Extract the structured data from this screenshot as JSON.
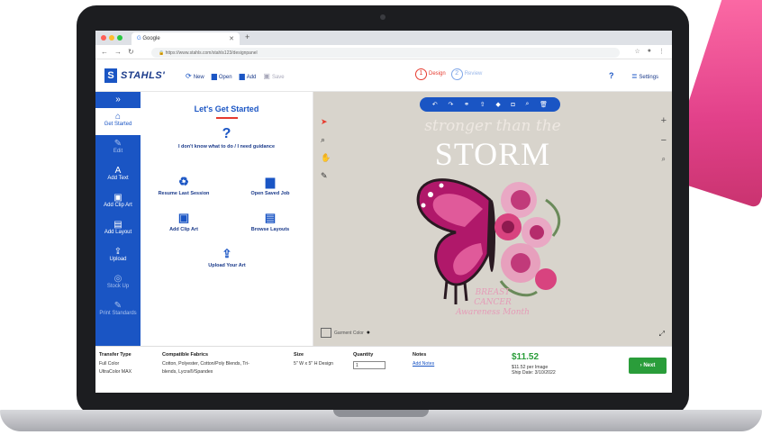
{
  "browser": {
    "tab_title": "Google",
    "url": "https://www.stahls.com/stahls123/designpanel"
  },
  "header": {
    "logo_text": "STAHLS'",
    "actions": [
      "New",
      "Open",
      "Add",
      "Save"
    ],
    "steps": [
      {
        "num": "1",
        "label": "Design"
      },
      {
        "num": "2",
        "label": "Review"
      }
    ],
    "help": "?",
    "settings": "Settings"
  },
  "sidebar": {
    "collapse": "»",
    "items": [
      {
        "label": "Get Started",
        "icon": "home-icon"
      },
      {
        "label": "Edit",
        "icon": "pencil-icon"
      },
      {
        "label": "Add Text",
        "icon": "text-icon"
      },
      {
        "label": "Add Clip Art",
        "icon": "image-icon"
      },
      {
        "label": "Add Layout",
        "icon": "layout-icon"
      },
      {
        "label": "Upload",
        "icon": "upload-icon"
      },
      {
        "label": "Stock Up",
        "icon": "stock-icon"
      },
      {
        "label": "Print Standards",
        "icon": "print-icon"
      }
    ]
  },
  "panel": {
    "title": "Let's Get Started",
    "question_mark": "?",
    "guidance": "I don't know what to do / I need guidance",
    "options": [
      {
        "label": "Resume Last Session",
        "icon": "recycle-icon"
      },
      {
        "label": "Open Saved Job",
        "icon": "folder-icon"
      },
      {
        "label": "Add Clip Art",
        "icon": "image-icon"
      },
      {
        "label": "Browse Layouts",
        "icon": "layouts-icon"
      },
      {
        "label": "Upload Your Art",
        "icon": "upload-icon"
      }
    ]
  },
  "canvas": {
    "art_line1": "stronger than the",
    "art_line2": "STORM",
    "art_sub": [
      "BREAST",
      "CANCER",
      "Awareness Month"
    ],
    "preview_label": "Garment Color"
  },
  "footer": {
    "transfer_type_header": "Transfer Type",
    "transfer_type_values": [
      "Full Color",
      "UltraColor MAX"
    ],
    "fabrics_header": "Compatible Fabrics",
    "fabrics_value": [
      "Cotton, Polyester, Cotton/Poly Blends, Tri-",
      "blends, Lycra®/Spandex"
    ],
    "size_header": "Size",
    "size_value": "5\" W x 5\" H Design",
    "quantity_header": "Quantity",
    "quantity_value": "1",
    "notes_header": "Notes",
    "notes_link": "Add Notes",
    "price": "$11.52",
    "price_per": "$11.52 per Image",
    "ship_date": "Ship Date: 3/10/2022",
    "next_label": "Next"
  },
  "colors": {
    "brand_blue": "#1a55c4",
    "accent_red": "#e63a2e",
    "success_green": "#2a9d3a",
    "canvas_bg": "#d8d4cc"
  }
}
